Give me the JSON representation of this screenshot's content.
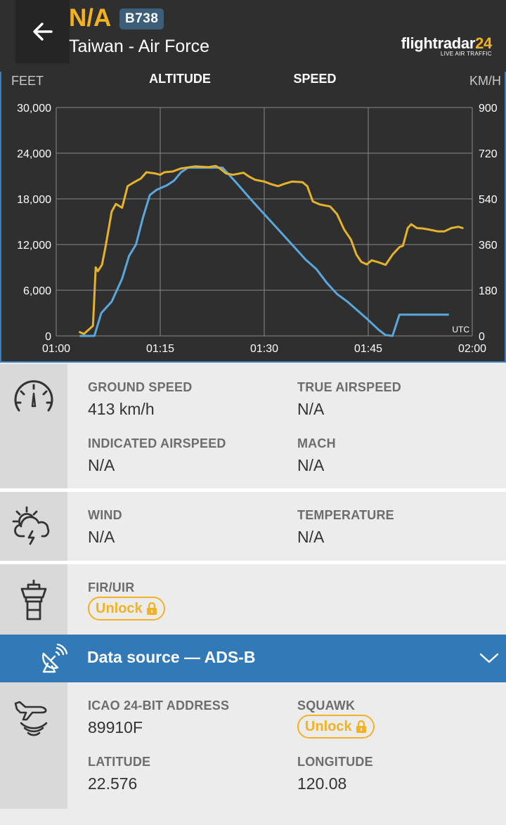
{
  "header": {
    "flight_code": "N/A",
    "aircraft_type": "B738",
    "operator": "Taiwan - Air Force",
    "brand_name_main": "flightradar",
    "brand_name_accent": "24",
    "brand_tagline": "LIVE AIR TRAFFIC"
  },
  "colors": {
    "header_bg": "#2f2f2f",
    "accent_yellow": "#f4b223",
    "altitude_line": "#5aa7de",
    "speed_line": "#e5b22c",
    "datasource_bar": "#3279b7"
  },
  "icons": {
    "back": "arrow-left-icon",
    "speed": "speedometer-icon",
    "weather": "sun-cloud-icon",
    "airspace": "control-tower-icon",
    "datasource": "satellite-dish-icon",
    "expand": "chevron-down-icon",
    "transponder": "plane-signal-icon",
    "lock": "lock-icon"
  },
  "chart_data": {
    "type": "line",
    "titles": [
      "ALTITUDE",
      "SPEED"
    ],
    "left_unit": "FEET",
    "right_unit": "KM/H",
    "timezone_label": "UTC",
    "x_ticks": [
      "01:00",
      "01:15",
      "01:30",
      "01:45",
      "02:00"
    ],
    "x_range_minutes": [
      0,
      60
    ],
    "y_left_ticks": [
      "30,000",
      "24,000",
      "18,000",
      "12,000",
      "6,000",
      "0"
    ],
    "y_left_range": [
      0,
      30000
    ],
    "y_right_ticks": [
      "900",
      "720",
      "540",
      "360",
      "180",
      "0"
    ],
    "y_right_range": [
      0,
      900
    ],
    "grid": true,
    "series": [
      {
        "name": "ALTITUDE",
        "axis": "left",
        "points": [
          [
            3.5,
            0
          ],
          [
            5.5,
            0
          ],
          [
            6.5,
            3000
          ],
          [
            8,
            4500
          ],
          [
            9.5,
            7500
          ],
          [
            10.5,
            10500
          ],
          [
            11.5,
            12000
          ],
          [
            12.5,
            15500
          ],
          [
            13.5,
            18500
          ],
          [
            14.5,
            19200
          ],
          [
            16,
            19800
          ],
          [
            17,
            20400
          ],
          [
            18,
            21500
          ],
          [
            19,
            22100
          ],
          [
            21,
            22100
          ],
          [
            24,
            22100
          ],
          [
            26,
            20100
          ],
          [
            28,
            18000
          ],
          [
            30,
            16000
          ],
          [
            32,
            14000
          ],
          [
            34,
            12000
          ],
          [
            36,
            10000
          ],
          [
            37.5,
            8800
          ],
          [
            39,
            7000
          ],
          [
            40.5,
            5500
          ],
          [
            42,
            4500
          ],
          [
            43.5,
            3300
          ],
          [
            45,
            2100
          ],
          [
            46.5,
            800
          ],
          [
            47.5,
            100
          ],
          [
            48.5,
            0
          ],
          [
            49.5,
            2800
          ],
          [
            56.5,
            2800
          ]
        ]
      },
      {
        "name": "SPEED",
        "axis": "right",
        "points": [
          [
            3.4,
            15
          ],
          [
            4,
            8
          ],
          [
            5.3,
            40
          ],
          [
            5.7,
            270
          ],
          [
            6,
            255
          ],
          [
            6.6,
            280
          ],
          [
            7.1,
            350
          ],
          [
            8,
            490
          ],
          [
            8.6,
            520
          ],
          [
            9.5,
            505
          ],
          [
            10.3,
            590
          ],
          [
            11.2,
            605
          ],
          [
            12.2,
            620
          ],
          [
            13,
            645
          ],
          [
            14.3,
            640
          ],
          [
            15,
            635
          ],
          [
            15.6,
            645
          ],
          [
            16.8,
            648
          ],
          [
            18,
            660
          ],
          [
            20,
            668
          ],
          [
            22,
            665
          ],
          [
            23,
            670
          ],
          [
            23.6,
            660
          ],
          [
            24.5,
            640
          ],
          [
            25.5,
            635
          ],
          [
            27,
            643
          ],
          [
            27.8,
            628
          ],
          [
            28.7,
            615
          ],
          [
            30,
            608
          ],
          [
            31,
            598
          ],
          [
            32,
            590
          ],
          [
            33,
            600
          ],
          [
            34,
            608
          ],
          [
            35.5,
            606
          ],
          [
            36.2,
            590
          ],
          [
            37,
            530
          ],
          [
            38,
            518
          ],
          [
            39.5,
            510
          ],
          [
            40.5,
            480
          ],
          [
            41.5,
            420
          ],
          [
            42.5,
            380
          ],
          [
            43.3,
            320
          ],
          [
            44,
            292
          ],
          [
            44.8,
            282
          ],
          [
            45.5,
            298
          ],
          [
            46.5,
            290
          ],
          [
            47.5,
            280
          ],
          [
            48.5,
            320
          ],
          [
            49.5,
            350
          ],
          [
            50,
            355
          ],
          [
            50.7,
            425
          ],
          [
            51.2,
            440
          ],
          [
            52,
            425
          ],
          [
            53,
            423
          ],
          [
            54,
            418
          ],
          [
            55,
            412
          ],
          [
            56,
            412
          ],
          [
            57,
            425
          ],
          [
            58,
            430
          ],
          [
            58.6,
            425
          ]
        ]
      }
    ]
  },
  "speed_section": {
    "ground_speed_label": "GROUND SPEED",
    "ground_speed_value": "413 km/h",
    "true_airspeed_label": "TRUE AIRSPEED",
    "true_airspeed_value": "N/A",
    "indicated_airspeed_label": "INDICATED AIRSPEED",
    "indicated_airspeed_value": "N/A",
    "mach_label": "MACH",
    "mach_value": "N/A"
  },
  "weather_section": {
    "wind_label": "WIND",
    "wind_value": "N/A",
    "temperature_label": "TEMPERATURE",
    "temperature_value": "N/A"
  },
  "airspace_section": {
    "fir_label": "FIR/UIR",
    "unlock_label": "Unlock"
  },
  "datasource": {
    "title": "Data source — ADS-B"
  },
  "transponder_section": {
    "icao_label": "ICAO 24-BIT ADDRESS",
    "icao_value": "89910F",
    "squawk_label": "SQUAWK",
    "squawk_unlock_label": "Unlock",
    "latitude_label": "LATITUDE",
    "latitude_value": "22.576",
    "longitude_label": "LONGITUDE",
    "longitude_value": "120.08"
  }
}
